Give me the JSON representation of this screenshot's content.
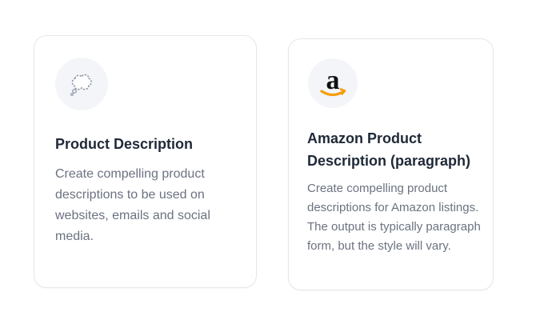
{
  "cards": [
    {
      "icon": "thought-bubble-icon",
      "title": "Product Description",
      "description": "Create compelling product descriptions to be used on websites, emails and social media."
    },
    {
      "icon": "amazon-logo-icon",
      "title": "Amazon Product Description (paragraph)",
      "description": "Create compelling product descriptions for Amazon listings. The output is typically paragraph form, but the style will vary."
    }
  ],
  "colors": {
    "title": "#1f2937",
    "description": "#6b7280",
    "card_border": "#e5e7eb",
    "icon_background": "#f3f5f8",
    "amazon_smile": "#f59e0b"
  }
}
